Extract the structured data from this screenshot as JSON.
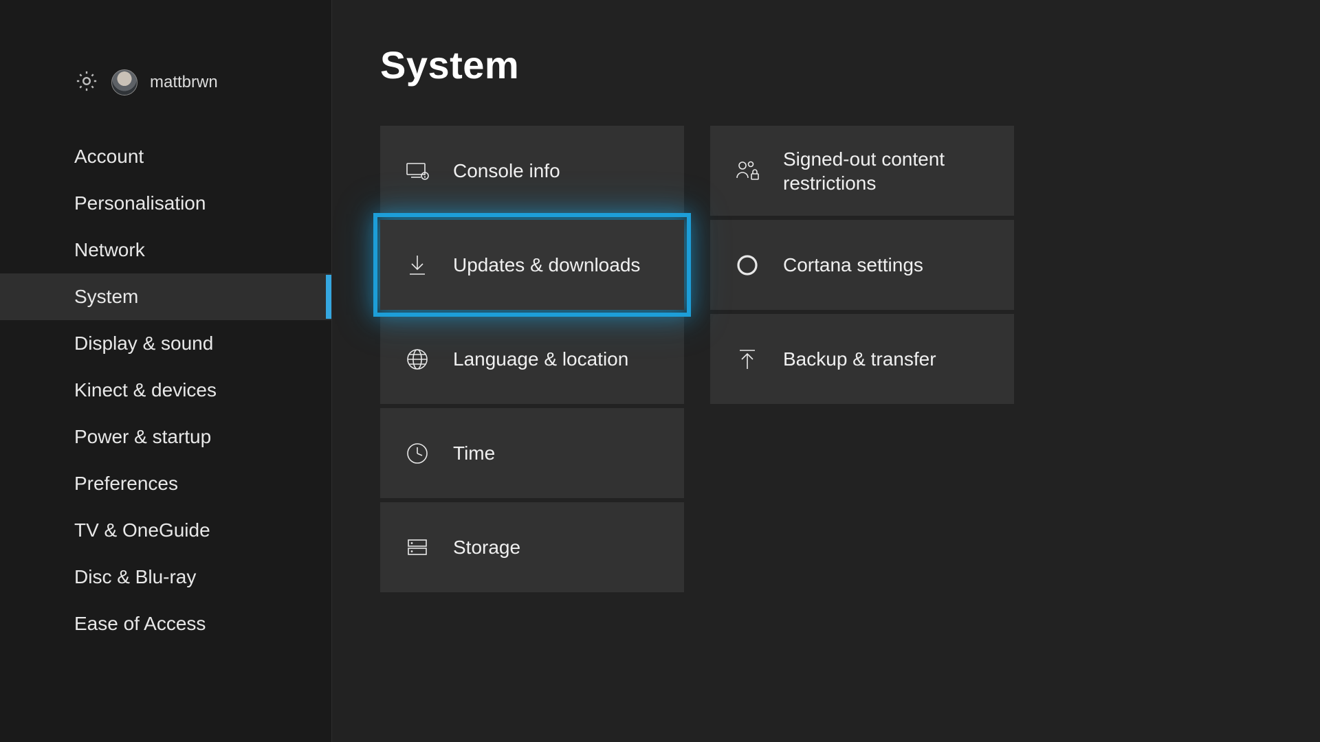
{
  "header": {
    "username": "mattbrwn"
  },
  "sidebar": {
    "items": [
      {
        "label": "Account",
        "id": "account"
      },
      {
        "label": "Personalisation",
        "id": "personalisation"
      },
      {
        "label": "Network",
        "id": "network"
      },
      {
        "label": "System",
        "id": "system",
        "active": true
      },
      {
        "label": "Display & sound",
        "id": "display-sound"
      },
      {
        "label": "Kinect & devices",
        "id": "kinect-devices"
      },
      {
        "label": "Power & startup",
        "id": "power-startup"
      },
      {
        "label": "Preferences",
        "id": "preferences"
      },
      {
        "label": "TV & OneGuide",
        "id": "tv-oneguide"
      },
      {
        "label": "Disc & Blu-ray",
        "id": "disc-bluray"
      },
      {
        "label": "Ease of Access",
        "id": "ease-of-access"
      }
    ]
  },
  "main": {
    "title": "System",
    "columns": [
      [
        {
          "label": "Console info",
          "icon": "console-info",
          "id": "console-info"
        },
        {
          "label": "Updates & downloads",
          "icon": "download",
          "id": "updates-downloads",
          "focused": true
        },
        {
          "label": "Language & location",
          "icon": "globe",
          "id": "language-location"
        },
        {
          "label": "Time",
          "icon": "clock",
          "id": "time"
        },
        {
          "label": "Storage",
          "icon": "storage",
          "id": "storage"
        }
      ],
      [
        {
          "label": "Signed-out content restrictions",
          "icon": "people-lock",
          "id": "content-restrictions"
        },
        {
          "label": "Cortana settings",
          "icon": "cortana",
          "id": "cortana-settings"
        },
        {
          "label": "Backup & transfer",
          "icon": "upload",
          "id": "backup-transfer"
        }
      ]
    ]
  },
  "colors": {
    "accent": "#1d9ed8",
    "bg": "#222222",
    "sidebar": "#1a1a1a",
    "tile": "#323232"
  }
}
